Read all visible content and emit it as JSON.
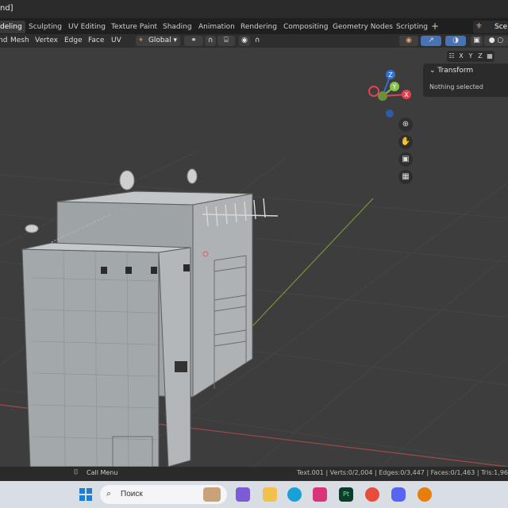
{
  "window": {
    "title_fragment": "nd]"
  },
  "tabs": [
    {
      "label": "deling",
      "active": true
    },
    {
      "label": "Sculpting"
    },
    {
      "label": "UV Editing"
    },
    {
      "label": "Texture Paint"
    },
    {
      "label": "Shading"
    },
    {
      "label": "Animation"
    },
    {
      "label": "Rendering"
    },
    {
      "label": "Compositing"
    },
    {
      "label": "Geometry Nodes"
    },
    {
      "label": "Scripting"
    }
  ],
  "add_tab": "+",
  "scene_label": "Scen",
  "header": {
    "menus": [
      "nd",
      "Mesh",
      "Vertex",
      "Edge",
      "Face",
      "UV"
    ],
    "transform_orientation": "Global"
  },
  "npanel": {
    "axes": [
      "X",
      "Y",
      "Z"
    ],
    "section": "Transform",
    "empty_text": "Nothing selected"
  },
  "gizmo": {
    "x": "X",
    "y": "Y",
    "z": "Z"
  },
  "status": {
    "left": "Call Menu",
    "stats": "Text.001 | Verts:0/2,004 | Edges:0/3,447 | Faces:0/1,463 | Tris:1,96"
  },
  "taskbar": {
    "search_placeholder": "Поиск",
    "icons": [
      "windows-start-icon",
      "search-icon",
      "clipchamp-icon",
      "file-explorer-icon",
      "edge-icon",
      "instagram-icon",
      "pt-icon",
      "chrome-icon",
      "discord-icon",
      "blender-icon"
    ],
    "pt_label": "Pt"
  },
  "colors": {
    "active_blue": "#4772b3",
    "axis_x": "#e2424f",
    "axis_y": "#8bc34a",
    "axis_z": "#2f6fd6"
  }
}
